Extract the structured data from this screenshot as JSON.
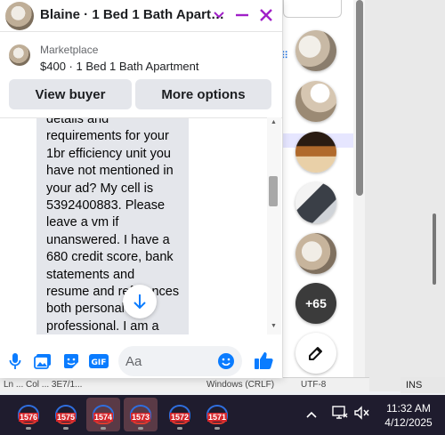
{
  "chat": {
    "title": "Blaine · 1 Bed 1 Bath Apart…",
    "context_label": "Marketplace",
    "context_listing": "$400 · 1 Bed 1 Bath Apartment",
    "buttons": {
      "view_buyer": "View buyer",
      "more_options": "More options"
    },
    "message": "details and\nrequirements for your\n1br efficiency unit you\nhave not mentioned in\nyour ad? My cell is\n5392400883. Please\nleave a vm if\nunanswered. I have a\n680 credit score, bank\nstatements and\nresume and references\nboth personal and\nprofessional. I am a",
    "composer_placeholder": "Aa",
    "composer_icons": [
      "mic-icon",
      "photo-icon",
      "sticker-icon",
      "gif-icon",
      "emoji-icon",
      "like-icon"
    ]
  },
  "bubbles": {
    "more_count": "+65"
  },
  "statusbar": {
    "text_left": "Ln ... Col ... 3E7/1...",
    "text_mid": "Windows (CRLF)",
    "text_right": "UTF-8"
  },
  "ins_label": "INS",
  "taskbar": {
    "apps": [
      {
        "label": "1576",
        "active": false
      },
      {
        "label": "1575",
        "active": false
      },
      {
        "label": "1574",
        "active": true
      },
      {
        "label": "1573",
        "active": true
      },
      {
        "label": "1572",
        "active": false
      },
      {
        "label": "1571",
        "active": false
      }
    ],
    "time": "11:32 AM",
    "date": "4/12/2025"
  },
  "colors": {
    "accent": "#a020c8",
    "messenger_blue": "#0a7cff",
    "bubble_bg": "#e4e6eb"
  }
}
